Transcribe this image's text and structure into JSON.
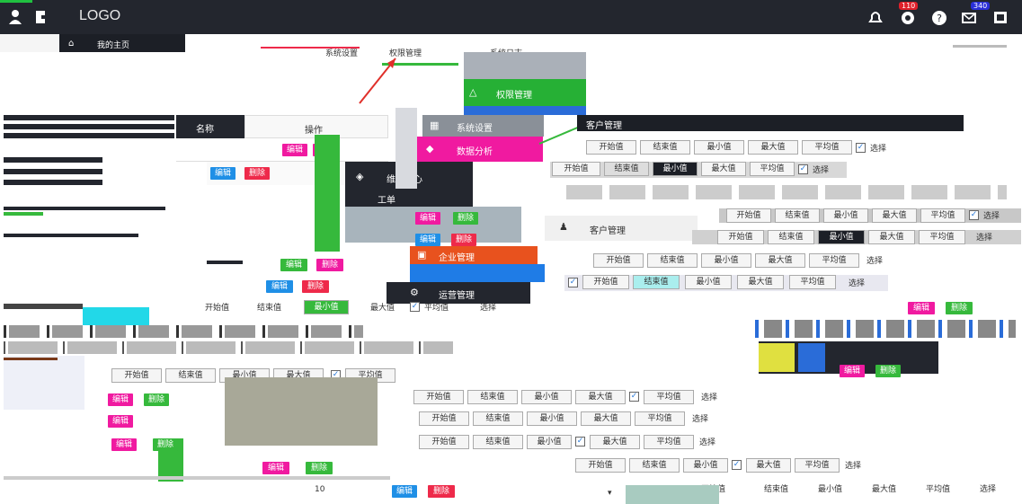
{
  "header": {
    "logo": "LOGO",
    "user_icon": "user-icon",
    "exit_icon": "exit-icon",
    "badge_1": "110",
    "badge_2": "340",
    "icons": [
      "notification-icon",
      "power-icon",
      "help-icon",
      "mail-icon",
      "fullscreen-icon"
    ]
  },
  "nav": {
    "home_label": "我的主页",
    "tab_a": "系统设置",
    "tab_b": "权限管理",
    "tab_c": "系统日志"
  },
  "menus": {
    "menu1": {
      "item1": "权限管理",
      "item2": "系统设置",
      "item3": "客户管理"
    },
    "menu2": {
      "item1": "维保中心",
      "item2": "工单"
    },
    "menu3": {
      "item1": "企业管理",
      "item2": "运营管理"
    },
    "menu_right": {
      "item1": "客户管理"
    },
    "orange_item": "数据分析"
  },
  "table": {
    "col_name": "名称",
    "col_action": "操作",
    "edit": "编辑",
    "delete": "删除",
    "page": "10"
  },
  "filters": {
    "start": "开始值",
    "end": "结束值",
    "min": "最小值",
    "max": "最大值",
    "avg": "平均值",
    "select": "选择",
    "check_mark": "✓"
  },
  "colors": {
    "topbar": "#23262e",
    "accent_green": "#20c040",
    "blue": "#1f8fe6",
    "red": "#ee2a4a",
    "green": "#36b93c",
    "pink": "#f01aa0",
    "orange": "#e8521e"
  }
}
